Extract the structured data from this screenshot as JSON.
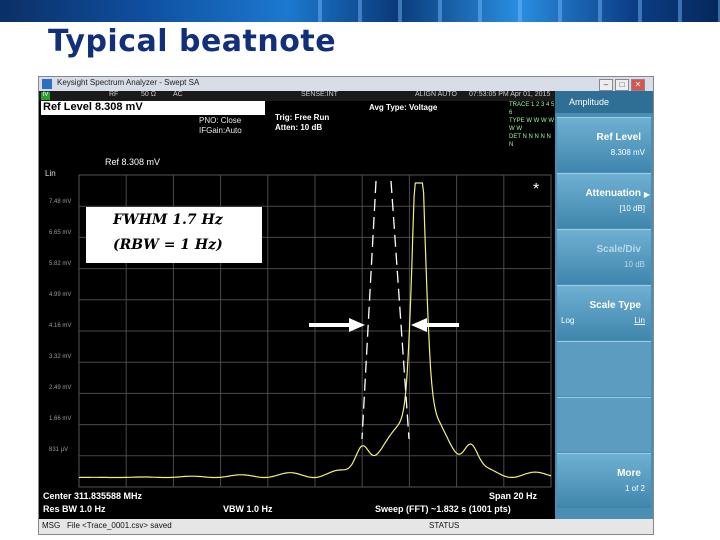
{
  "slide": {
    "title": "Typical beatnote"
  },
  "window": {
    "title": "Keysight Spectrum Analyzer - Swept SA",
    "minimize": "–",
    "maximize": "□",
    "close": "✕"
  },
  "menubar": {
    "indicator": "IV",
    "items": [
      "RF",
      "50 Ω",
      "AC",
      "SENSE:INT",
      "ALIGN AUTO",
      "07:53:05 PM Apr 01, 2015"
    ]
  },
  "header": {
    "ref_level": "Ref Level 8.308 mV",
    "pno": "PNO: Close",
    "if_gain": "IFGain:Auto",
    "trig": "Trig: Free Run",
    "atten": "Atten: 10 dB",
    "avg_type": "Avg Type: Voltage",
    "trace_rows": [
      "TRACE 1 2 3 4 5 6",
      "TYPE W W W W W W",
      "DET N N N N N N"
    ]
  },
  "plot": {
    "scale_mode": "Lin",
    "ref_label": "Ref 8.308 mV",
    "marker_star": "*",
    "y_ticks": [
      "7.48 mV",
      "6.65 mV",
      "5.82 mV",
      "4.99 mV",
      "4.16 mV",
      "3.32 mV",
      "2.49 mV",
      "1.66 mV",
      "831 µV"
    ]
  },
  "annotation": {
    "line1": "FWHM 1.7 Hz",
    "line2": "(RBW = 1 Hz)"
  },
  "footer": {
    "center": "Center 311.835588 MHz",
    "res_bw": "Res BW 1.0 Hz",
    "vbw": "VBW 1.0 Hz",
    "span": "Span 20 Hz",
    "sweep": "Sweep (FFT)  ~1.832 s (1001 pts)"
  },
  "statusbar": {
    "msg": "MSG",
    "file_msg": "File <Trace_0001.csv> saved",
    "status": "STATUS"
  },
  "softkeys": {
    "menu_title": "Amplitude",
    "keys": [
      {
        "label": "Ref Level",
        "value": "8.308 mV"
      },
      {
        "label": "Attenuation",
        "value": "[10 dB]"
      },
      {
        "label": "Scale/Div",
        "value": "10 dB"
      },
      {
        "label": "Scale Type",
        "left": "Log",
        "value": "Lin"
      },
      {
        "label": "",
        "value": ""
      },
      {
        "label": "",
        "value": ""
      },
      {
        "label": "More",
        "value": "1 of 2"
      }
    ]
  },
  "colors": {
    "trace": "#f3f07a",
    "screen_bg": "#000000",
    "softkey": "#4a8fb3",
    "title": "#12307a"
  }
}
